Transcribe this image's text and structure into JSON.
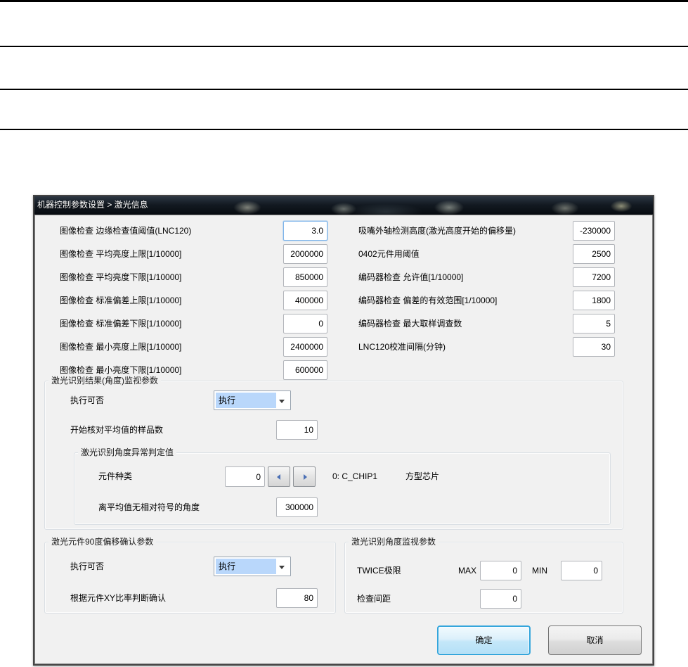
{
  "colors": {
    "accent_button_border": "#35a6dc",
    "combo_highlight": "#b9d7fb",
    "titlebar_bg": "#10161e",
    "client_bg": "#f1f1f1"
  },
  "window": {
    "title": "机器控制参数设置 > 激光信息"
  },
  "fields_left": [
    {
      "label": "图像检查 边缘检查值阈值(LNC120)",
      "value": "3.0"
    },
    {
      "label": "图像检查 平均亮度上限[1/10000]",
      "value": "2000000"
    },
    {
      "label": "图像检查 平均亮度下限[1/10000]",
      "value": "850000"
    },
    {
      "label": "图像检查 标准偏差上限[1/10000]",
      "value": "400000"
    },
    {
      "label": "图像检查 标准偏差下限[1/10000]",
      "value": "0"
    },
    {
      "label": "图像检查 最小亮度上限[1/10000]",
      "value": "2400000"
    },
    {
      "label": "图像检查 最小亮度下限[1/10000]",
      "value": "600000"
    }
  ],
  "fields_right": [
    {
      "label": "吸嘴外轴检测高度(激光高度开始的偏移量)",
      "value": "-230000"
    },
    {
      "label": "0402元件用阈值",
      "value": "2500"
    },
    {
      "label": "编码器检查 允许值[1/10000]",
      "value": "7200"
    },
    {
      "label": "编码器检查 偏差的有效范围[1/10000]",
      "value": "1800"
    },
    {
      "label": "编码器检查 最大取样调查数",
      "value": "5"
    },
    {
      "label": "LNC120校准间隔(分钟)",
      "value": "30"
    }
  ],
  "group_laser_angle_result": {
    "title": "激光识别结果(角度)监视参数",
    "execute": {
      "label": "执行可否",
      "value": "执行"
    },
    "samples": {
      "label": "开始核对平均值的样品数",
      "value": "10"
    },
    "abnormal_group": {
      "title": "激光识别角度异常判定值",
      "part_type": {
        "label": "元件种类",
        "value": "0",
        "desc_code": "0: C_CHIP1",
        "desc_name": "方型芯片"
      },
      "angle": {
        "label": "离平均值无相对符号的角度",
        "value": "300000"
      }
    }
  },
  "group_90deg": {
    "title": "激光元件90度偏移确认参数",
    "execute": {
      "label": "执行可否",
      "value": "执行"
    },
    "ratio": {
      "label": "根据元件XY比率判断确认",
      "value": "80"
    }
  },
  "group_angle_monitor": {
    "title": "激光识别角度监视参数",
    "twice": {
      "label": "TWICE极限",
      "max_label": "MAX",
      "max_value": "0",
      "min_label": "MIN",
      "min_value": "0"
    },
    "gap": {
      "label": "检查间距",
      "value": "0"
    }
  },
  "buttons": {
    "ok": "确定",
    "cancel": "取消"
  }
}
